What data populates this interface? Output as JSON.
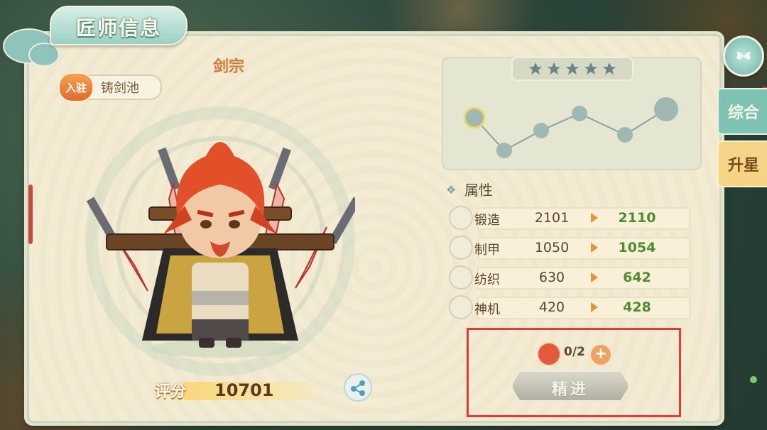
{
  "window": {
    "title": "匠师信息"
  },
  "tabs": [
    {
      "label": "综合"
    },
    {
      "label": "升星"
    }
  ],
  "artisan": {
    "faction": "剑宗",
    "station_badge": "入驻",
    "station_name": "铸剑池",
    "score_label": "评分",
    "score_value": "10701"
  },
  "stars": {
    "count": 5,
    "filled": 0
  },
  "attributes": {
    "title": "属性",
    "rows": [
      {
        "name": "锻造",
        "current": "2101",
        "next": "2110",
        "icon": "forge-icon"
      },
      {
        "name": "制甲",
        "current": "1050",
        "next": "1054",
        "icon": "armor-icon"
      },
      {
        "name": "纺织",
        "current": "630",
        "next": "642",
        "icon": "weave-icon"
      },
      {
        "name": "神机",
        "current": "420",
        "next": "428",
        "icon": "machine-icon"
      }
    ]
  },
  "refine": {
    "item_count": "0/2",
    "plus": "+",
    "button_label": "精进"
  },
  "colors": {
    "panel": "#f3ebd3",
    "accent_teal": "#7ec2b4",
    "next_value": "#4f8b2f",
    "highlight": "#e43a3a"
  }
}
